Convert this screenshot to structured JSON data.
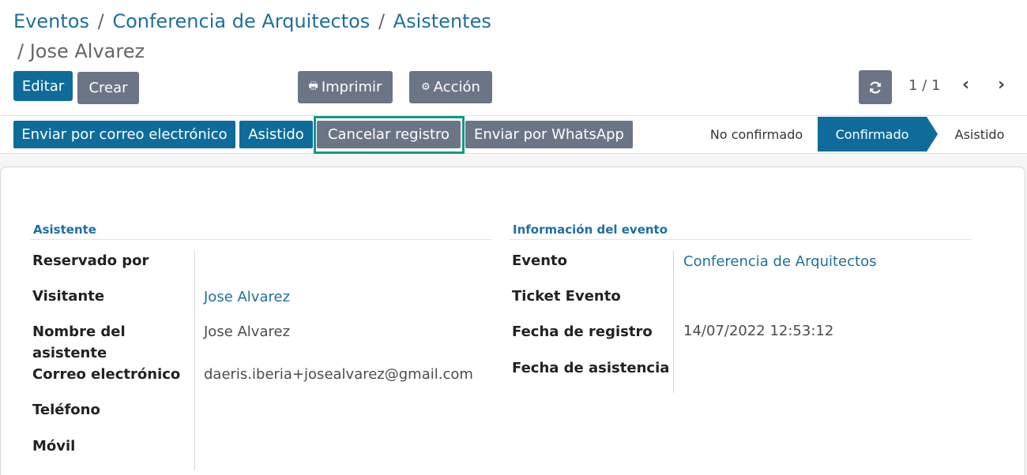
{
  "breadcrumb": {
    "items": [
      "Eventos",
      "Conferencia de Arquitectos",
      "Asistentes"
    ],
    "separator": "/",
    "current": "/ Jose Alvarez"
  },
  "toolbar": {
    "edit_label": "Editar",
    "create_label": "Crear",
    "print_label": "Imprimir",
    "action_label": "Acción"
  },
  "pager": {
    "value": "1 / 1"
  },
  "statusbar": {
    "buttons": [
      "Enviar por correo electrónico",
      "Asistido",
      "Cancelar registro",
      "Enviar por WhatsApp"
    ],
    "stages": [
      "No confirmado",
      "Confirmado",
      "Asistido"
    ],
    "active_stage": "Confirmado"
  },
  "attendee": {
    "title": "Asistente",
    "fields": [
      {
        "label": "Reservado por",
        "value": ""
      },
      {
        "label": "Visitante",
        "value": "Jose Alvarez"
      },
      {
        "label": "Nombre del asistente",
        "value": "Jose Alvarez"
      },
      {
        "label": "Correo electrónico",
        "value": "daeris.iberia+josealvarez@gmail.com"
      },
      {
        "label": "Teléfono",
        "value": ""
      },
      {
        "label": "Móvil",
        "value": ""
      }
    ]
  },
  "event_info": {
    "title": "Información del evento",
    "fields": [
      {
        "label": "Evento",
        "value": "Conferencia de Arquitectos"
      },
      {
        "label": "Ticket Evento",
        "value": ""
      },
      {
        "label": "Fecha de registro",
        "value": "14/07/2022 12:53:12"
      },
      {
        "label": "Fecha de asistencia",
        "value": ""
      }
    ]
  },
  "colors": {
    "primary": "#0f6c9a",
    "secondary": "#6c7585",
    "link": "#1f6f9f",
    "highlight": "#13988a"
  }
}
